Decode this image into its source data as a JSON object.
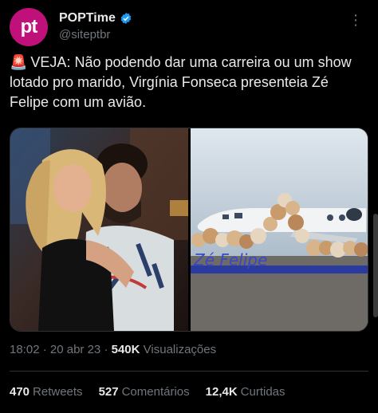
{
  "author": {
    "display_name": "POPTime",
    "handle": "@siteptbr",
    "avatar_text": "pt",
    "avatar_color": "#c0107a",
    "verified_icon": "verified-badge-icon"
  },
  "tweet": {
    "emoji": "🚨",
    "text": "VEJA: Não podendo dar uma carreira ou um show lotado pro marido, Virgínia Fonseca presenteia Zé Felipe com um avião.",
    "more_icon": "more-options-icon"
  },
  "media": {
    "right_banner_text": "Zé Felipe"
  },
  "meta": {
    "time": "18:02",
    "date": "20 abr 23",
    "views_count": "540K",
    "views_label": "Visualizações"
  },
  "stats": {
    "retweets_count": "470",
    "retweets_label": "Retweets",
    "comments_count": "527",
    "comments_label": "Comentários",
    "likes_count": "12,4K",
    "likes_label": "Curtidas"
  },
  "colors": {
    "background": "#000000",
    "text": "#e7e9ea",
    "secondary": "#71767b",
    "verified": "#1d9bf0"
  }
}
